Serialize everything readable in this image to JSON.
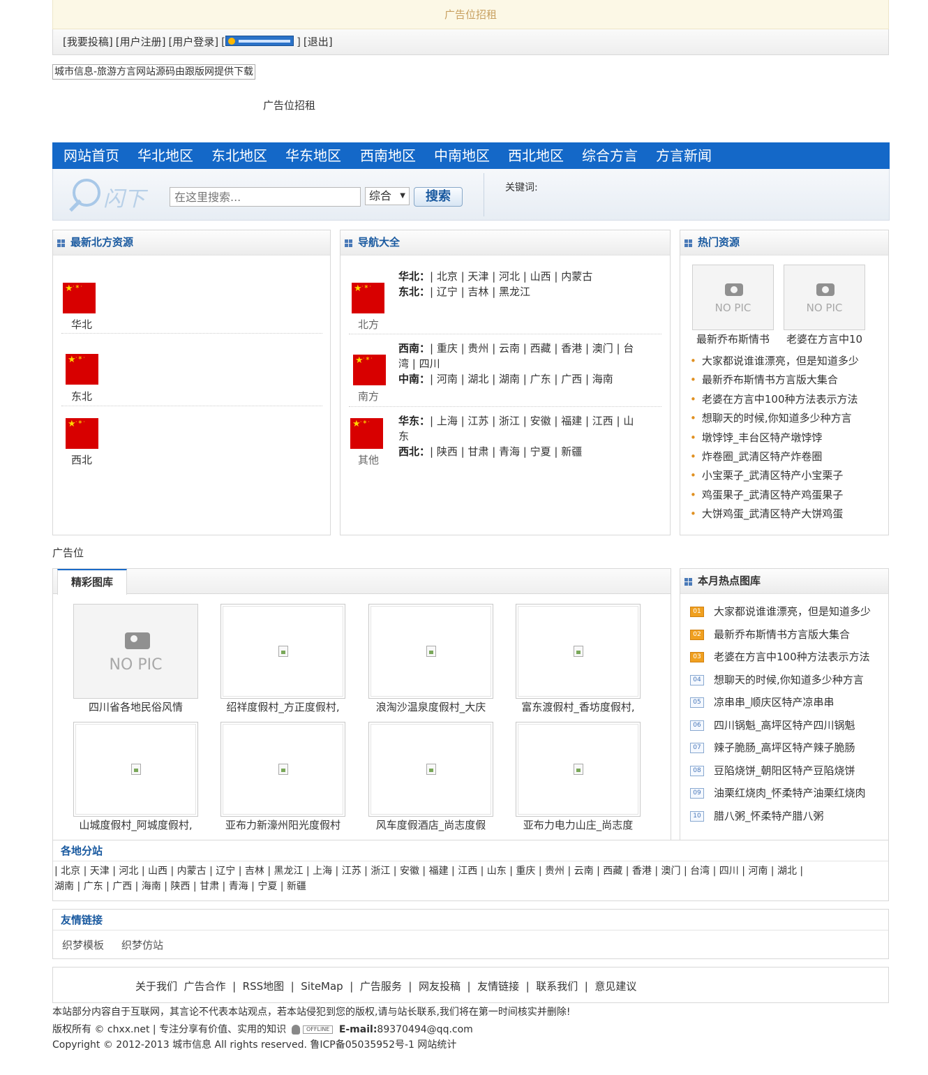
{
  "top_ad": "广告位招租",
  "userbar": {
    "submit": "[我要投稿]",
    "register": "[用户注册]",
    "login": "[用户登录]",
    "qq_open": "[",
    "qq_close": "]",
    "logout": "[退出]"
  },
  "logo_text": "城市信息-旅游方言网站源码由跟版网提供下载",
  "ad_banner": "广告位招租",
  "nav": [
    "网站首页",
    "华北地区",
    "东北地区",
    "华东地区",
    "西南地区",
    "中南地区",
    "西北地区",
    "综合方言",
    "方言新闻"
  ],
  "search": {
    "placeholder": "在这里搜索...",
    "select": "综合",
    "button": "搜索",
    "keywords_label": "关键词:",
    "logo_text": "闪下"
  },
  "latest": {
    "title": "最新北方资源",
    "items": [
      "华北",
      "东北",
      "西北"
    ]
  },
  "nav_all": {
    "title": "导航大全",
    "groups": [
      {
        "label": "北方",
        "lines": [
          [
            "华北：",
            "| 北京 | 天津 | 河北 | 山西 | 内蒙古"
          ],
          [
            "东北：",
            "| 辽宁 | 吉林 | 黑龙江"
          ]
        ]
      },
      {
        "label": "南方",
        "lines": [
          [
            "西南：",
            "| 重庆 | 贵州 | 云南 | 西藏 | 香港 | 澳门 | 台"
          ],
          [
            "",
            "湾 | 四川"
          ],
          [
            "中南：",
            "| 河南 | 湖北 | 湖南 | 广东 | 广西 | 海南"
          ]
        ]
      },
      {
        "label": "其他",
        "lines": [
          [
            "华东：",
            "| 上海 | 江苏 | 浙江 | 安徽 | 福建 | 江西 | 山"
          ],
          [
            "",
            "东"
          ],
          [
            "西北：",
            "| 陕西 | 甘肃 | 青海 | 宁夏 | 新疆"
          ]
        ]
      }
    ]
  },
  "hot": {
    "title": "热门资源",
    "pics": [
      {
        "label": "NO PIC",
        "caption": "最新乔布斯情书"
      },
      {
        "label": "NO PIC",
        "caption": "老婆在方言中10"
      }
    ],
    "list": [
      "大家都说谁谁漂亮，但是知道多少",
      "最新乔布斯情书方言版大集合",
      "老婆在方言中100种方法表示方法",
      "想聊天的时候,你知道多少种方言",
      "墩饽饽_丰台区特产墩饽饽",
      "炸卷圈_武清区特产炸卷圈",
      "小宝栗子_武清区特产小宝栗子",
      "鸡蛋果子_武清区特产鸡蛋果子",
      "大饼鸡蛋_武清区特产大饼鸡蛋"
    ]
  },
  "ad_pos": "广告位",
  "gallery": {
    "tab": "精彩图库",
    "nopic": "NO PIC",
    "items": [
      "四川省各地民俗风情",
      "绍祥度假村_方正度假村,",
      "浪淘沙温泉度假村_大庆",
      "富东渡假村_香坊度假村,",
      "山城度假村_阿城度假村,",
      "亚布力新濠州阳光度假村",
      "风车度假酒店_尚志度假",
      "亚布力电力山庄_尚志度"
    ]
  },
  "month_hot": {
    "title": "本月热点图库",
    "ranks": [
      "01",
      "02",
      "03",
      "04",
      "05",
      "06",
      "07",
      "08",
      "09",
      "10"
    ],
    "list": [
      "大家都说谁谁漂亮，但是知道多少",
      "最新乔布斯情书方言版大集合",
      "老婆在方言中100种方法表示方法",
      "想聊天的时候,你知道多少种方言",
      "凉串串_顺庆区特产凉串串",
      "四川锅魁_高坪区特产四川锅魁",
      "辣子脆肠_高坪区特产辣子脆肠",
      "豆陷烧饼_朝阳区特产豆陷烧饼",
      "油栗红烧肉_怀柔特产油栗红烧肉",
      "腊八粥_怀柔特产腊八粥"
    ]
  },
  "substations": {
    "title": "各地分站",
    "line1": "| 北京 | 天津 | 河北 | 山西 | 内蒙古 | 辽宁 | 吉林 | 黑龙江 | 上海 | 江苏 | 浙江 | 安徽 | 福建 | 江西 | 山东 | 重庆 | 贵州 | 云南 | 西藏 | 香港 | 澳门 | 台湾 | 四川 | 河南 | 湖北 |",
    "line2": "湖南 | 广东 | 广西 | 海南 | 陕西 | 甘肃 | 青海 | 宁夏 | 新疆"
  },
  "links": {
    "title": "友情链接",
    "items": [
      "织梦模板",
      "织梦仿站"
    ]
  },
  "footer": {
    "menu": "关于我们  广告合作  |  RSS地图  |  SiteMap  |  广告服务  |  网友投稿  |  友情链接  |  联系我们  |  意见建议",
    "disclaimer": "本站部分内容自于互联网，其言论不代表本站观点，若本站侵犯到您的版权,请与站长联系,我们将在第一时间核实并删除!",
    "copyright_pre": "版权所有 © chxx.net | 专注分享有价值、实用的知识",
    "offline": "OFFLINE",
    "email_label": "E-mail:",
    "email": "89370494@qq.com",
    "copyright": "Copyright © 2012-2013 城市信息 All rights reserved. 鲁ICP备05035952号-1 网站统计"
  },
  "colors": {
    "nav_bg": "#1468c8",
    "title_blue": "#1a5aa0",
    "ad_bg": "#fcf8e6",
    "flag_red": "#d80000",
    "rank_orange": "#f0a020"
  }
}
